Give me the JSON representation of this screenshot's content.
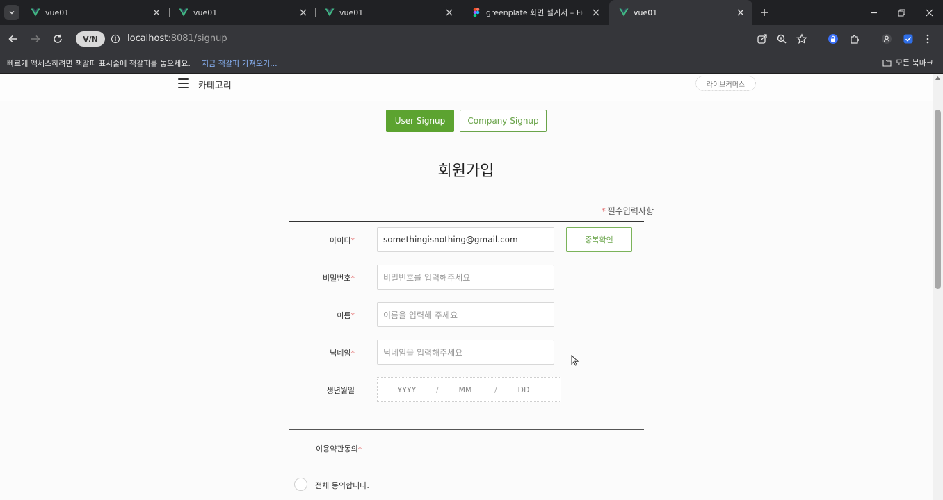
{
  "browser": {
    "tabs": [
      {
        "title": "vue01",
        "icon": "vue-logo-icon",
        "active": false
      },
      {
        "title": "vue01",
        "icon": "vue-logo-icon",
        "active": false
      },
      {
        "title": "vue01",
        "icon": "vue-logo-icon",
        "active": false
      },
      {
        "title": "greenplate 화면 설계서 – Figma",
        "icon": "figma-logo-icon",
        "active": false
      },
      {
        "title": "vue01",
        "icon": "vue-logo-icon",
        "active": true
      }
    ],
    "vn_badge": "V/N",
    "url_host": "localhost",
    "url_path": ":8081/signup",
    "bookmarks_prompt": "빠르게 액세스하려면 책갈피 표시줄에 책갈피를 놓으세요.",
    "bookmarks_link": "지금 책갈피 가져오기...",
    "all_bookmarks": "모든 북마크"
  },
  "site": {
    "header": {
      "category_label": "카테고리",
      "live_commerce_label": "라이브커머스"
    },
    "signup_tabs": {
      "user": "User Signup",
      "company": "Company Signup"
    },
    "title": "회원가입",
    "required_note": "필수입력사항",
    "required_star": "*",
    "fields": {
      "id": {
        "label": "아이디",
        "value": "somethingisnothing@gmail.com"
      },
      "password": {
        "label": "비밀번호",
        "placeholder": "비밀번호를 입력해주세요"
      },
      "name": {
        "label": "이름",
        "placeholder": "이름을 입력해 주세요"
      },
      "nickname": {
        "label": "닉네임",
        "placeholder": "닉네임을 입력해주세요"
      },
      "birthdate": {
        "label": "생년월일",
        "year": "YYYY",
        "month": "MM",
        "day": "DD",
        "separator": "/"
      }
    },
    "duplicate_check_label": "중복확인",
    "terms_label": "이용약관동의",
    "agree_all_label": "전체 동의합니다."
  },
  "colors": {
    "primary_green": "#5ca330",
    "required_red": "#e36b6b"
  }
}
